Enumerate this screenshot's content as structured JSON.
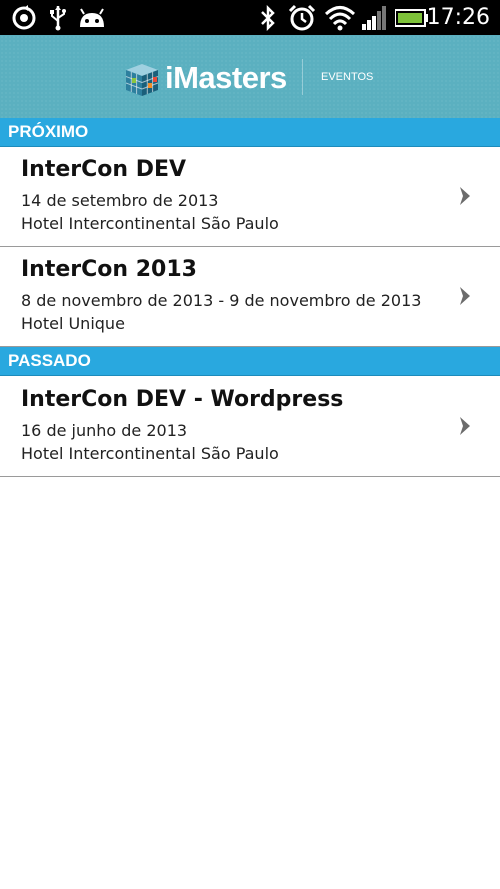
{
  "status_bar": {
    "time": "17:26",
    "icons": [
      "sync-icon",
      "usb-icon",
      "android-icon",
      "bluetooth-icon",
      "alarm-icon",
      "wifi-icon",
      "signal-icon",
      "battery-icon"
    ]
  },
  "header": {
    "logo_text": "iMasters",
    "section_label": "EVENTOS"
  },
  "sections": [
    {
      "label": "PRÓXIMO",
      "events": [
        {
          "title": "InterCon DEV",
          "date": "14 de setembro de 2013",
          "place": "Hotel Intercontinental São Paulo"
        },
        {
          "title": "InterCon 2013",
          "date": "8 de novembro de 2013 - 9 de novembro de 2013",
          "place": "Hotel Unique"
        }
      ]
    },
    {
      "label": "PASSADO",
      "events": [
        {
          "title": "InterCon DEV - Wordpress",
          "date": "16 de junho de 2013",
          "place": "Hotel Intercontinental São Paulo"
        }
      ]
    }
  ],
  "colors": {
    "header_bg": "#5bb0c0",
    "section_bg": "#29a8df",
    "battery": "#7ec23a",
    "chevron": "#6b6b6b"
  }
}
